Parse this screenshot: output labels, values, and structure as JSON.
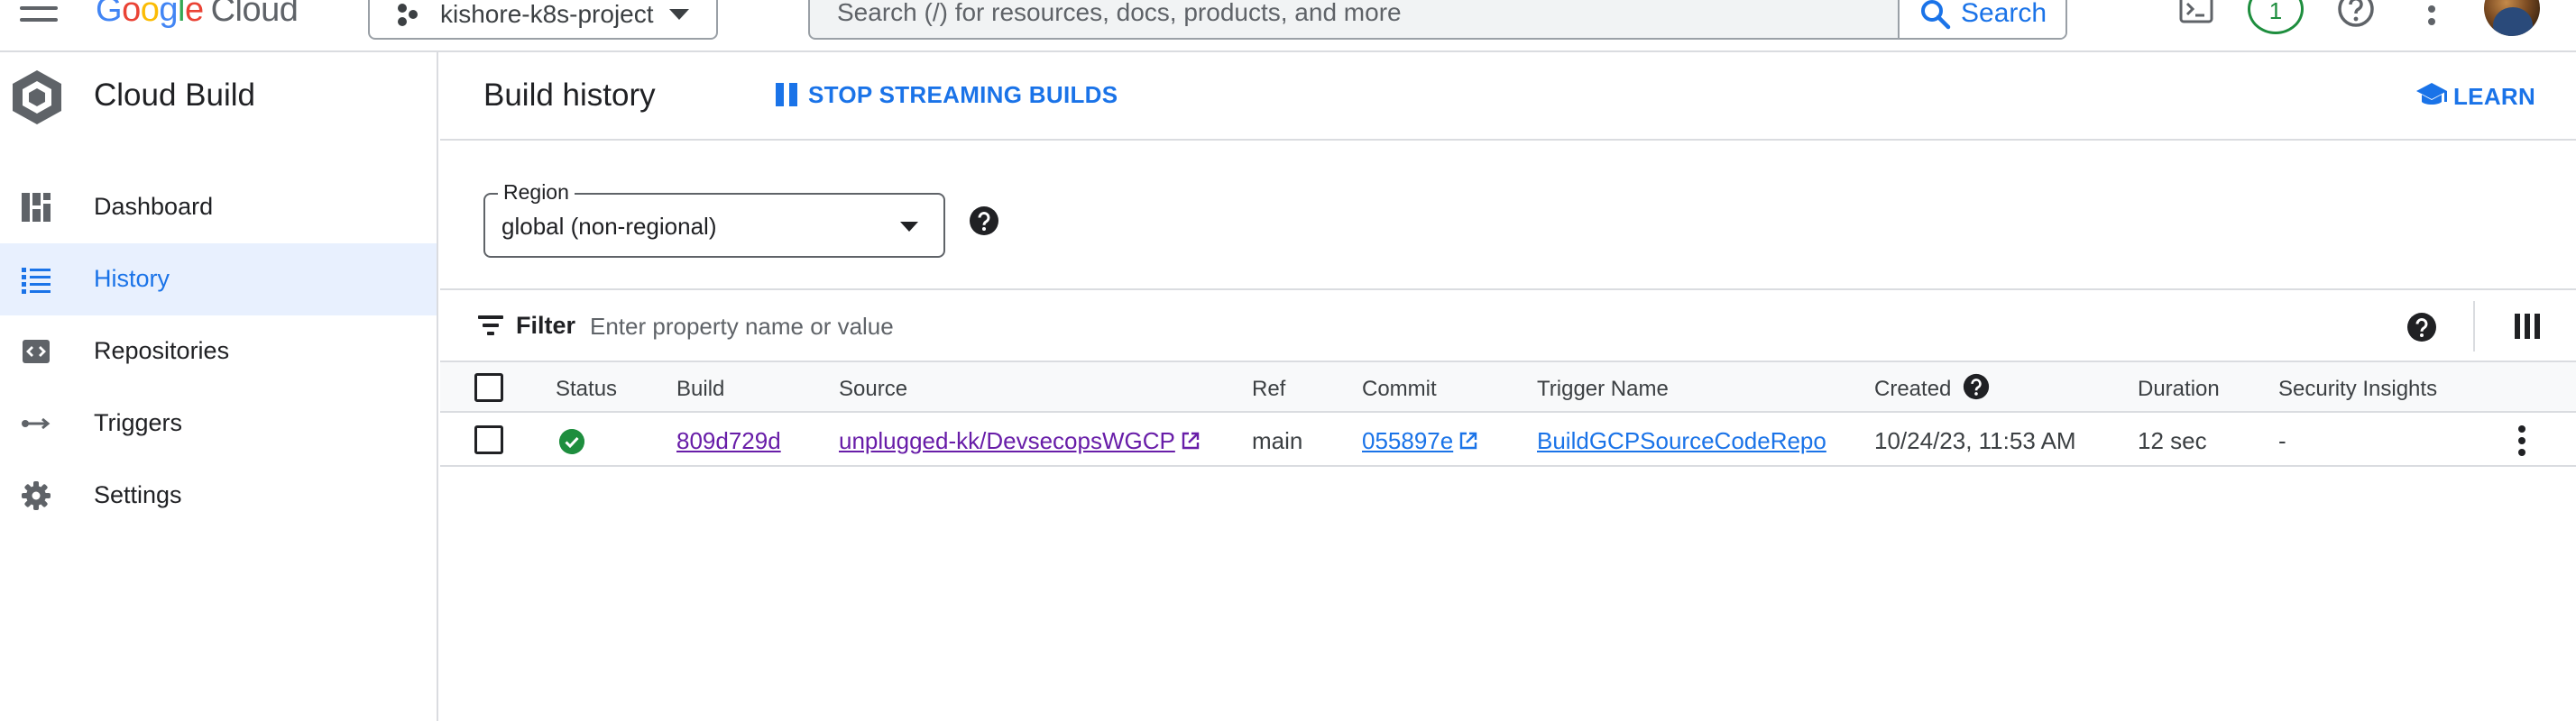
{
  "topbar": {
    "logo_letters": [
      "G",
      "o",
      "o",
      "g",
      "l",
      "e"
    ],
    "logo_product": "Cloud",
    "project_name": "kishore-k8s-project",
    "search_placeholder": "Search (/) for resources, docs, products, and more",
    "search_button": "Search",
    "notification_count": "1",
    "icons": [
      "menu-icon",
      "project-icon",
      "search-icon",
      "terminal-icon",
      "help-icon",
      "more-vert-icon",
      "avatar"
    ]
  },
  "sidebar": {
    "product_title": "Cloud Build",
    "items": [
      {
        "label": "Dashboard",
        "icon": "dashboard-icon",
        "active": false
      },
      {
        "label": "History",
        "icon": "list-icon",
        "active": true
      },
      {
        "label": "Repositories",
        "icon": "repository-icon",
        "active": false
      },
      {
        "label": "Triggers",
        "icon": "triggers-icon",
        "active": false
      },
      {
        "label": "Settings",
        "icon": "settings-icon",
        "active": false
      }
    ]
  },
  "header": {
    "title": "Build history",
    "stop_streaming": "STOP STREAMING BUILDS",
    "learn": "LEARN"
  },
  "region": {
    "label": "Region",
    "value": "global (non-regional)"
  },
  "filter": {
    "label": "Filter",
    "placeholder": "Enter property name or value"
  },
  "table": {
    "columns": [
      "Status",
      "Build",
      "Source",
      "Ref",
      "Commit",
      "Trigger Name",
      "Created",
      "Duration",
      "Security Insights"
    ],
    "rows": [
      {
        "status": "success",
        "build": "809d729d",
        "source": "unplugged-kk/DevsecopsWGCP",
        "ref": "main",
        "commit": "055897e",
        "trigger_name": "BuildGCPSourceCodeRepo",
        "created": "10/24/23, 11:53 AM",
        "duration": "12 sec",
        "security_insights": "-"
      }
    ]
  },
  "colors": {
    "accent": "#1a73e8",
    "active_bg": "#e8f0fe",
    "visited_link": "#681da8",
    "success": "#1e8e3e",
    "border": "#dadce0"
  }
}
